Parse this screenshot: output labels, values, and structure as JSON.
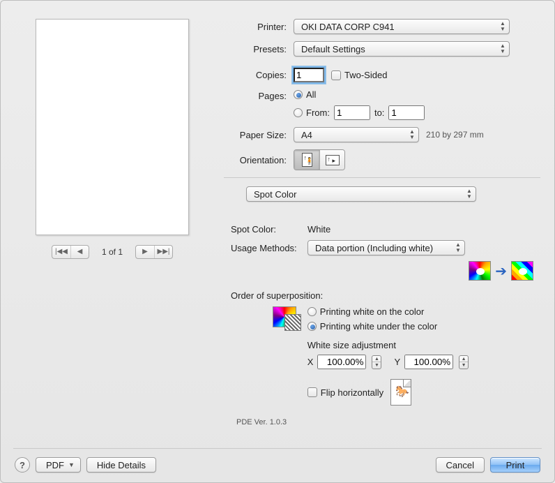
{
  "labels": {
    "printer": "Printer:",
    "presets": "Presets:",
    "copies": "Copies:",
    "two_sided": "Two-Sided",
    "pages": "Pages:",
    "all": "All",
    "from": "From:",
    "to": "to:",
    "paper_size": "Paper Size:",
    "orientation": "Orientation:",
    "spot_color": "Spot Color:",
    "usage_methods": "Usage Methods:",
    "order_super": "Order of superposition:",
    "white_on": "Printing white on the color",
    "white_under": "Printing white under the color",
    "white_adj": "White size adjustment",
    "x": "X",
    "y": "Y",
    "flip_h": "Flip horizontally"
  },
  "values": {
    "printer": "OKI DATA CORP C941",
    "presets": "Default Settings",
    "copies": "1",
    "pages_from": "1",
    "pages_to": "1",
    "paper_size": "A4",
    "paper_dims": "210 by 297 mm",
    "section": "Spot Color",
    "spot_color": "White",
    "usage_method": "Data portion (Including white)",
    "white_x": "100.00%",
    "white_y": "100.00%"
  },
  "pager": {
    "label": "1 of 1"
  },
  "version": {
    "label": "PDE Ver.  1.0.3"
  },
  "footer": {
    "pdf": "PDF",
    "hide_details": "Hide Details",
    "cancel": "Cancel",
    "print": "Print"
  }
}
